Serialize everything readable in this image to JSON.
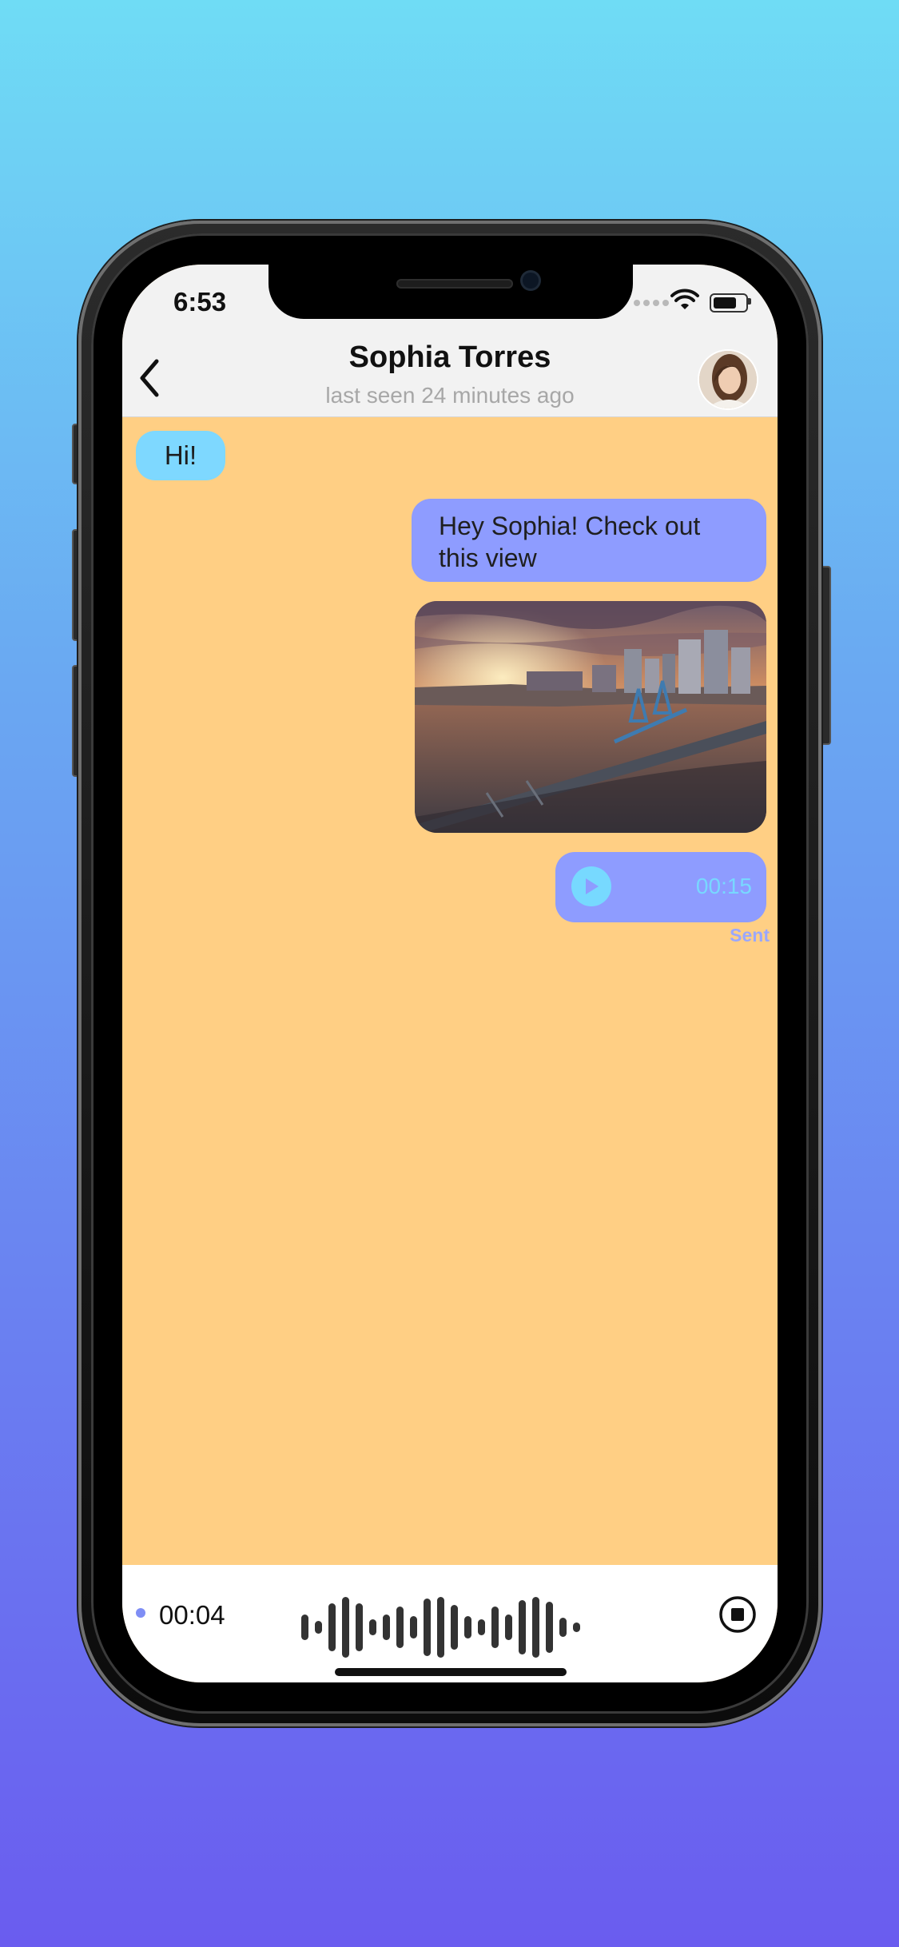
{
  "status_bar": {
    "time": "6:53"
  },
  "header": {
    "contact_name": "Sophia Torres",
    "last_seen": "last seen 24 minutes ago"
  },
  "messages": {
    "incoming_1": "Hi!",
    "outgoing_1": "Hey Sophia! Check out this view",
    "audio_duration": "00:15",
    "delivery_status": "Sent"
  },
  "recording": {
    "elapsed": "00:04"
  },
  "colors": {
    "background_top": "#6fdcf5",
    "background_bottom": "#6a5cef",
    "chat_background": "#ffcf84",
    "incoming_bubble": "#7ed8ff",
    "outgoing_bubble": "#8e9cff",
    "header_background": "#f2f2f2"
  },
  "icons": {
    "back": "chevron-left-icon",
    "wifi": "wifi-icon",
    "battery": "battery-icon",
    "play": "play-icon",
    "stop": "stop-icon",
    "waveform": "waveform-icon"
  }
}
